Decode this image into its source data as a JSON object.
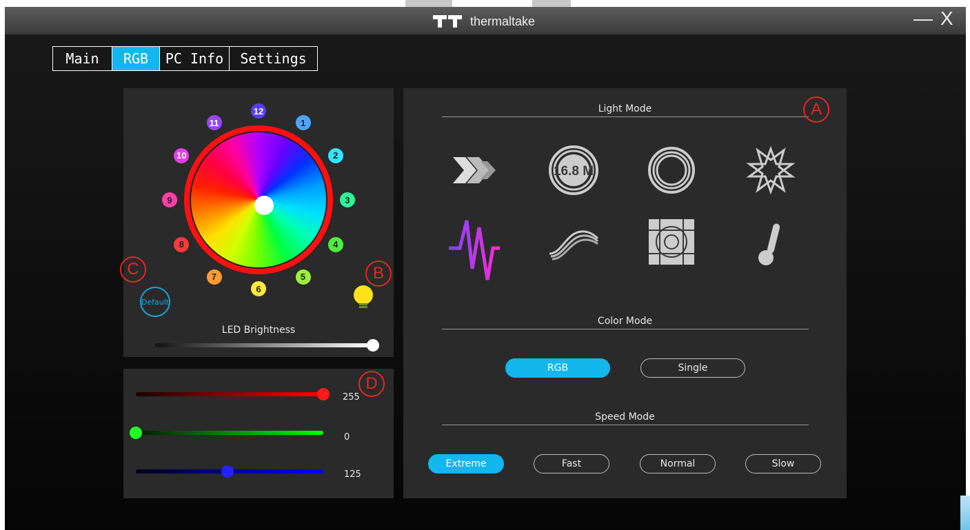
{
  "app": {
    "brand": "thermaltake"
  },
  "window_controls": {
    "minimize": "—",
    "close": "X"
  },
  "tabs": [
    {
      "label": "Main",
      "active": false
    },
    {
      "label": "RGB",
      "active": true
    },
    {
      "label": "PC Info",
      "active": false
    },
    {
      "label": "Settings",
      "active": false
    }
  ],
  "led_wheel": {
    "leds": [
      {
        "label": "12",
        "color": "#5a3cf0"
      },
      {
        "label": "1",
        "color": "#4fa3ff"
      },
      {
        "label": "2",
        "color": "#30e6ff"
      },
      {
        "label": "3",
        "color": "#2ef79a"
      },
      {
        "label": "4",
        "color": "#4cf03c"
      },
      {
        "label": "5",
        "color": "#9cf03c"
      },
      {
        "label": "6",
        "color": "#ffe93c"
      },
      {
        "label": "7",
        "color": "#ff9b30"
      },
      {
        "label": "8",
        "color": "#ff3a3a"
      },
      {
        "label": "9",
        "color": "#ff3fa8"
      },
      {
        "label": "10",
        "color": "#e23fe8"
      },
      {
        "label": "11",
        "color": "#9b45f0"
      }
    ],
    "default_label": "Default",
    "brightness_label": "LED Brightness",
    "brightness_level": 1.0
  },
  "rgb_sliders": [
    {
      "channel": "red",
      "value": "255",
      "fraction": 1.0,
      "color": "#ff0000"
    },
    {
      "channel": "green",
      "value": "0",
      "fraction": 0.0,
      "color": "#00ff00"
    },
    {
      "channel": "blue",
      "value": "125",
      "fraction": 0.49,
      "color": "#0000ff"
    }
  ],
  "light_mode": {
    "label": "Light Mode",
    "effects": [
      {
        "icon": "flow-chevrons-icon"
      },
      {
        "icon": "color-spectrum-icon",
        "text": "16.8 M"
      },
      {
        "icon": "ring-icon"
      },
      {
        "icon": "star-icon"
      },
      {
        "icon": "pulse-wave-icon"
      },
      {
        "icon": "wave-icon"
      },
      {
        "icon": "target-grid-icon"
      },
      {
        "icon": "thermometer-icon"
      }
    ]
  },
  "color_mode": {
    "label": "Color Mode",
    "options": [
      {
        "label": "RGB",
        "active": true
      },
      {
        "label": "Single",
        "active": false
      }
    ]
  },
  "speed_mode": {
    "label": "Speed Mode",
    "options": [
      {
        "label": "Extreme",
        "active": true
      },
      {
        "label": "Fast",
        "active": false
      },
      {
        "label": "Normal",
        "active": false
      },
      {
        "label": "Slow",
        "active": false
      }
    ]
  },
  "annotations": {
    "a": "A",
    "b": "B",
    "c": "C",
    "d": "D"
  },
  "colors": {
    "accent": "#14b6ee",
    "annotation": "#e22222"
  }
}
